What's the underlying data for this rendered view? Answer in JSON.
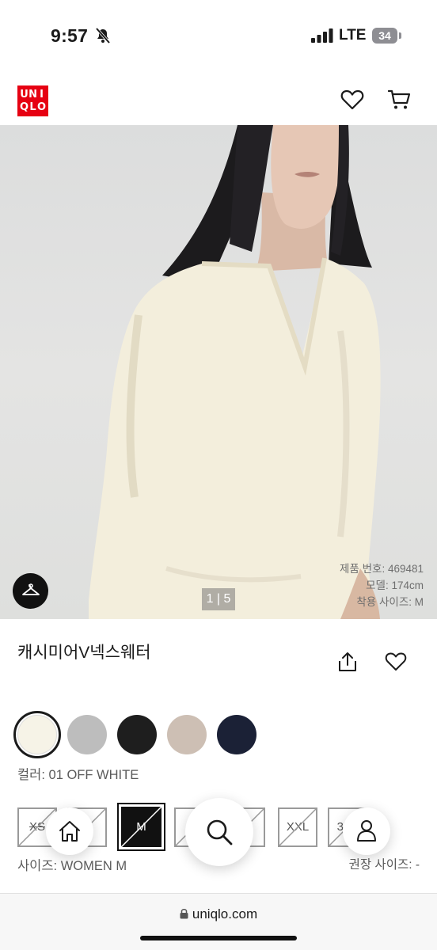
{
  "status_bar": {
    "time": "9:57",
    "network": "LTE",
    "battery": "34"
  },
  "header": {
    "brand_logo_letters": [
      "U",
      "N",
      "I",
      "Q",
      "L",
      "O"
    ]
  },
  "gallery": {
    "page_indicator": "1 | 5",
    "current_page": 1,
    "total_pages": 5,
    "model_info": {
      "product_number": "제품 번호: 469481",
      "model_height": "모델: 174cm",
      "fit_size": "착용 사이즈: M"
    }
  },
  "product": {
    "name": "캐시미어V넥스웨터",
    "colors": [
      {
        "name": "off-white",
        "hex": "#f6f3e7"
      },
      {
        "name": "gray",
        "hex": "#bdbdbd"
      },
      {
        "name": "black",
        "hex": "#1e1e1e"
      },
      {
        "name": "beige",
        "hex": "#cdbfb4"
      },
      {
        "name": "navy",
        "hex": "#1b2136"
      }
    ],
    "color_label": "컬러: 01 OFF WHITE",
    "sizes": [
      "XS",
      "S",
      "M",
      "L",
      "XL",
      "XXL",
      "3XL"
    ],
    "selected_size": "M",
    "size_label": "사이즈: WOMEN M",
    "recommended_size_label": "권장 사이즈: -"
  },
  "browser": {
    "url": "uniqlo.com"
  },
  "colors": {
    "brand_red": "#e60012"
  }
}
